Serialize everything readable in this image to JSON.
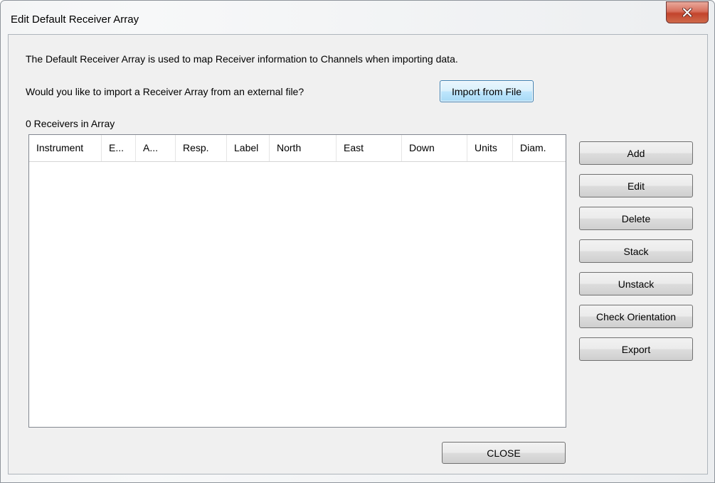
{
  "window": {
    "title": "Edit Default Receiver Array"
  },
  "intro": {
    "description": "The Default Receiver Array is used to map Receiver information to Channels when importing data.",
    "import_question": "Would you like to import a Receiver Array from an external file?",
    "import_button": "Import from File",
    "count_label": "0 Receivers in Array"
  },
  "table": {
    "columns": [
      "Instrument",
      "E...",
      "A...",
      "Resp.",
      "Label",
      "North",
      "East",
      "Down",
      "Units",
      "Diam."
    ],
    "rows": []
  },
  "side_buttons": {
    "add": "Add",
    "edit": "Edit",
    "delete": "Delete",
    "stack": "Stack",
    "unstack": "Unstack",
    "check_orientation": "Check Orientation",
    "export": "Export"
  },
  "footer": {
    "close": "CLOSE"
  },
  "icons": {
    "close": "close-icon"
  },
  "colors": {
    "close_button": "#c7472f",
    "focus_border": "#3c7fb1"
  }
}
